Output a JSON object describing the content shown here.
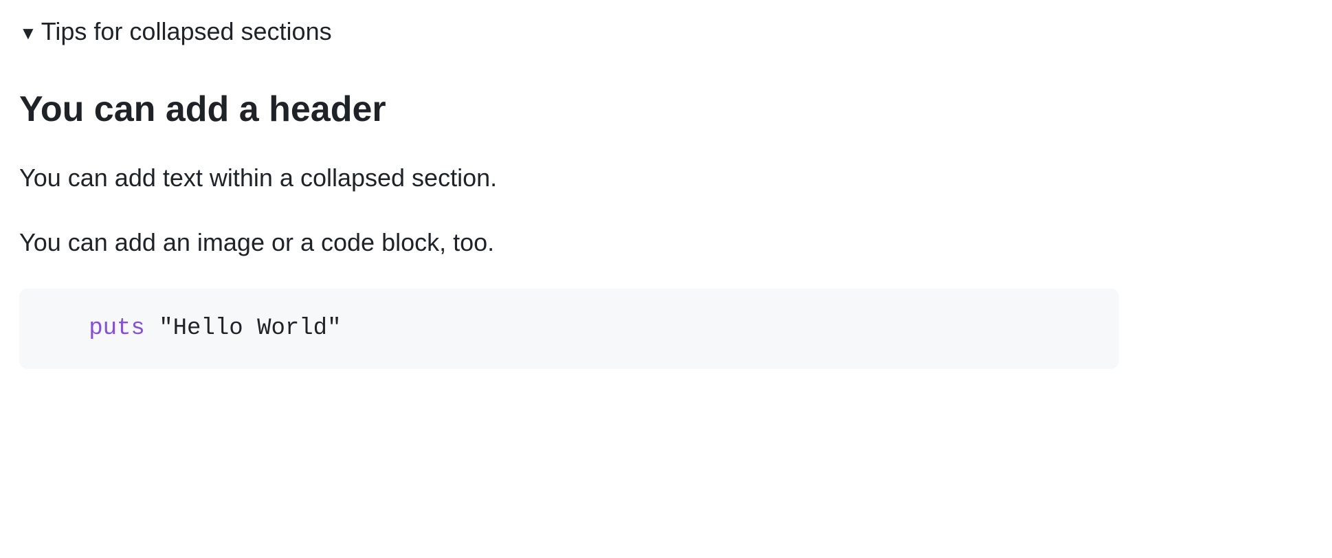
{
  "summary": {
    "label": "Tips for collapsed sections"
  },
  "content": {
    "heading": "You can add a header",
    "paragraph1": "You can add text within a collapsed section.",
    "paragraph2": "You can add an image or a code block, too."
  },
  "code": {
    "indent": "   ",
    "keyword": "puts",
    "space": " ",
    "string": "\"Hello World\""
  }
}
